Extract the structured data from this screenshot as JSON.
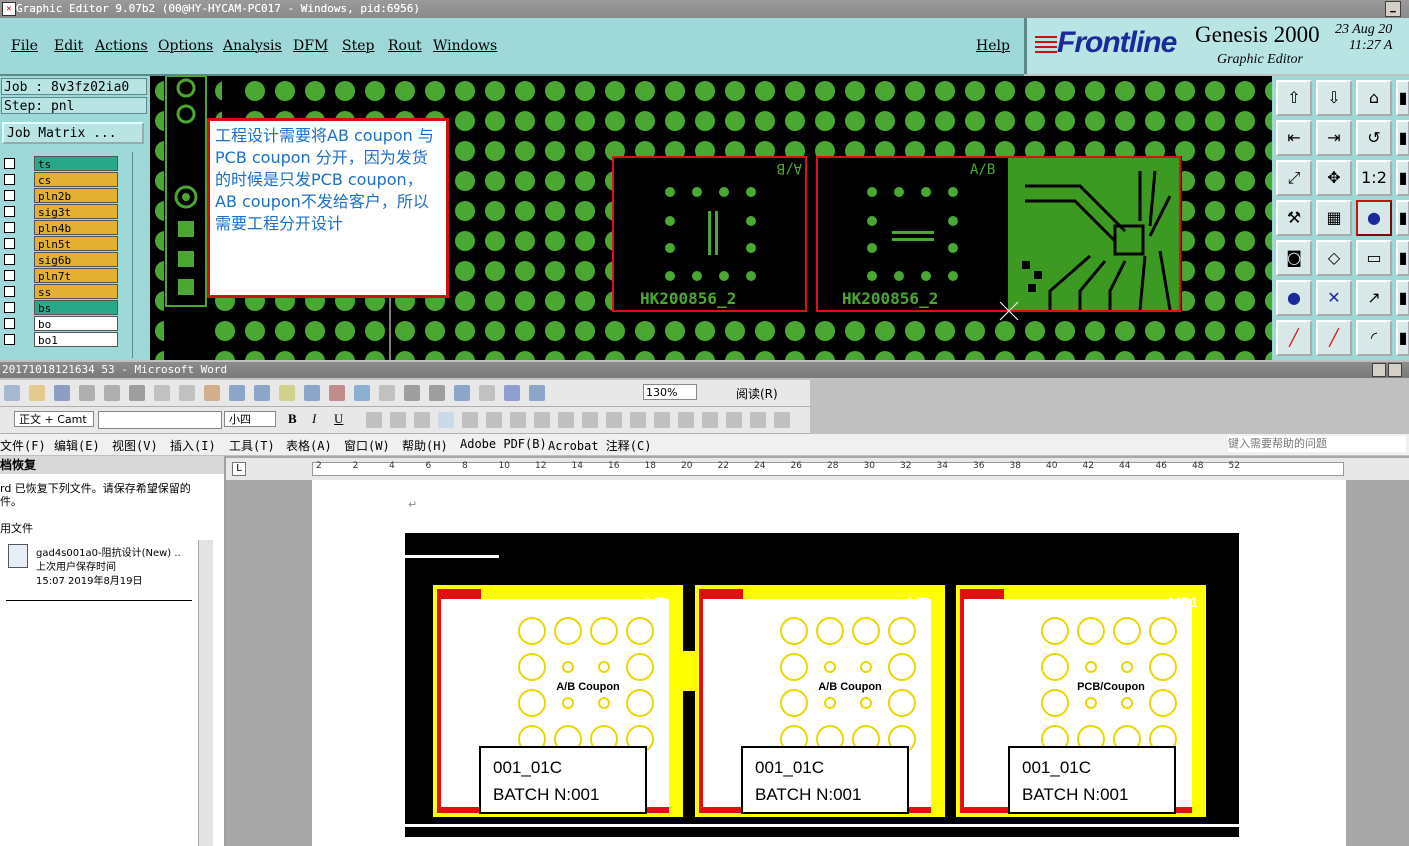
{
  "genesis": {
    "title": "Graphic Editor 9.07b2 (00@HY-HYCAM-PC017 - Windows, pid:6956)",
    "menu": [
      "File",
      "Edit",
      "Actions",
      "Options",
      "Analysis",
      "DFM",
      "Step",
      "Rout",
      "Windows"
    ],
    "help": "Help",
    "brand": {
      "logo": "Frontline",
      "product": "Genesis 2000",
      "subtitle": "Graphic Editor",
      "date": "23 Aug 20",
      "time": "11:27 A"
    },
    "job": "Job : 8v3fz02ia0",
    "step": "Step: pnl",
    "job_matrix": "Job Matrix ...",
    "layers": [
      {
        "name": "ts",
        "color": "#2aa88a"
      },
      {
        "name": "cs",
        "color": "#e2b032"
      },
      {
        "name": "pln2b",
        "color": "#e2b032"
      },
      {
        "name": "sig3t",
        "color": "#e2b032"
      },
      {
        "name": "pln4b",
        "color": "#e2b032"
      },
      {
        "name": "pln5t",
        "color": "#e2b032"
      },
      {
        "name": "sig6b",
        "color": "#e2b032"
      },
      {
        "name": "pln7t",
        "color": "#e2b032"
      },
      {
        "name": "ss",
        "color": "#e2b032"
      },
      {
        "name": "bs",
        "color": "#2aa88a"
      },
      {
        "name": "bo",
        "color": "#ffffff"
      },
      {
        "name": "bo1",
        "color": "#ffffff"
      }
    ],
    "note": "工程设计需要将AB coupon 与 PCB coupon 分开，因为发货的时候是只发PCB coupon，AB coupon不发给客户，所以需要工程分开设计",
    "coupon_mark": "A/B",
    "coupon_id": "HK200856_2"
  },
  "word": {
    "title": "20171018121634 53 - Microsoft Word",
    "zoom": "130%",
    "read_label": "阅读(R)",
    "style": "正文 + Camt",
    "size": "小四",
    "menu": [
      "文件(F)",
      "编辑(E)",
      "视图(V)",
      "插入(I)",
      "工具(T)",
      "表格(A)",
      "窗口(W)",
      "帮助(H)",
      "Adobe PDF(B)",
      "Acrobat 注释(C)"
    ],
    "help_placeholder": "键入需要帮助的问题",
    "pane": {
      "header": "档恢复",
      "line1": "rd 已恢复下列文件。请保存希望保留的",
      "line2": "件。",
      "section": "用文件",
      "file_name": "gad4s001a0-阻抗设计(New) ..",
      "file_sub": "上次用户保存时间",
      "file_time": "15:07 2019年8月19日"
    },
    "ruler_marks": [
      "2",
      "2",
      "4",
      "6",
      "8",
      "10",
      "12",
      "14",
      "16",
      "18",
      "20",
      "22",
      "24",
      "26",
      "28",
      "30",
      "32",
      "34",
      "36",
      "38",
      "40",
      "42",
      "44",
      "46",
      "48",
      "52"
    ],
    "coupons": [
      {
        "label": "A/B Coupon",
        "mark": "A/B",
        "line1": "001_01C",
        "line2": "BATCH N:001"
      },
      {
        "label": "A/B Coupon",
        "mark": "A/B",
        "line1": "001_01C",
        "line2": "BATCH N:001"
      },
      {
        "label": "PCB/Coupon",
        "mark": "A/B1",
        "line1": "001_01C",
        "line2": "BATCH N:001"
      }
    ]
  }
}
